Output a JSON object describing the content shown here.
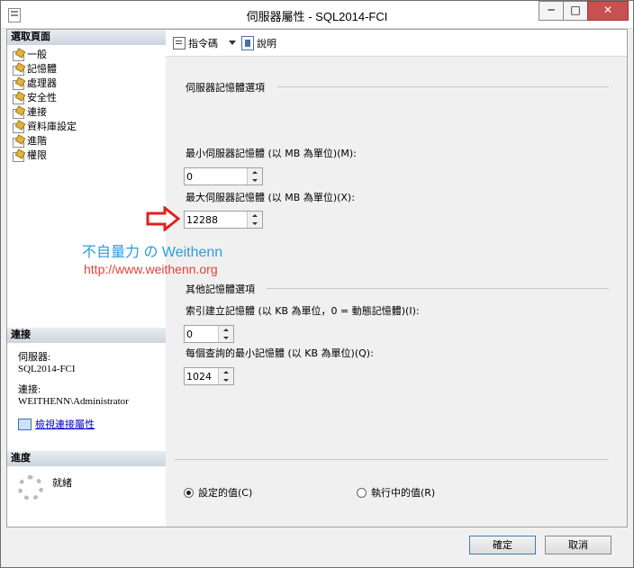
{
  "window": {
    "title": "伺服器屬性 - SQL2014-FCI",
    "min": "─",
    "max": "□",
    "close": "✕"
  },
  "left": {
    "select_page_title": "選取頁面",
    "pages": [
      "一般",
      "記憶體",
      "處理器",
      "安全性",
      "連接",
      "資料庫設定",
      "進階",
      "權限"
    ],
    "connection_title": "連接",
    "server_label": "伺服器:",
    "server_value": "SQL2014-FCI",
    "connection_label": "連接:",
    "connection_value": "WEITHENN\\Administrator",
    "view_conn_props": "檢視連接屬性",
    "progress_title": "進度",
    "status": "就緒"
  },
  "toolbar": {
    "script": "指令碼",
    "help": "說明"
  },
  "main": {
    "server_mem_group": "伺服器記憶體選項",
    "min_mem_label": "最小伺服器記憶體 (以 MB 為單位)(M):",
    "min_mem_value": "0",
    "max_mem_label": "最大伺服器記憶體 (以 MB 為單位)(X):",
    "max_mem_value": "12288",
    "other_mem_group": "其他記憶體選項",
    "index_mem_label": "索引建立記憶體 (以 KB 為單位，0 = 動態記憶體)(I):",
    "index_mem_value": "0",
    "query_mem_label": "每個查詢的最小記憶體 (以 KB 為單位)(Q):",
    "query_mem_value": "1024",
    "configured_values": "設定的值(C)",
    "running_values": "執行中的值(R)"
  },
  "watermark": {
    "line1": "不自量力 の Weithenn",
    "line2": "http://www.weithenn.org"
  },
  "buttons": {
    "ok": "確定",
    "cancel": "取消"
  }
}
